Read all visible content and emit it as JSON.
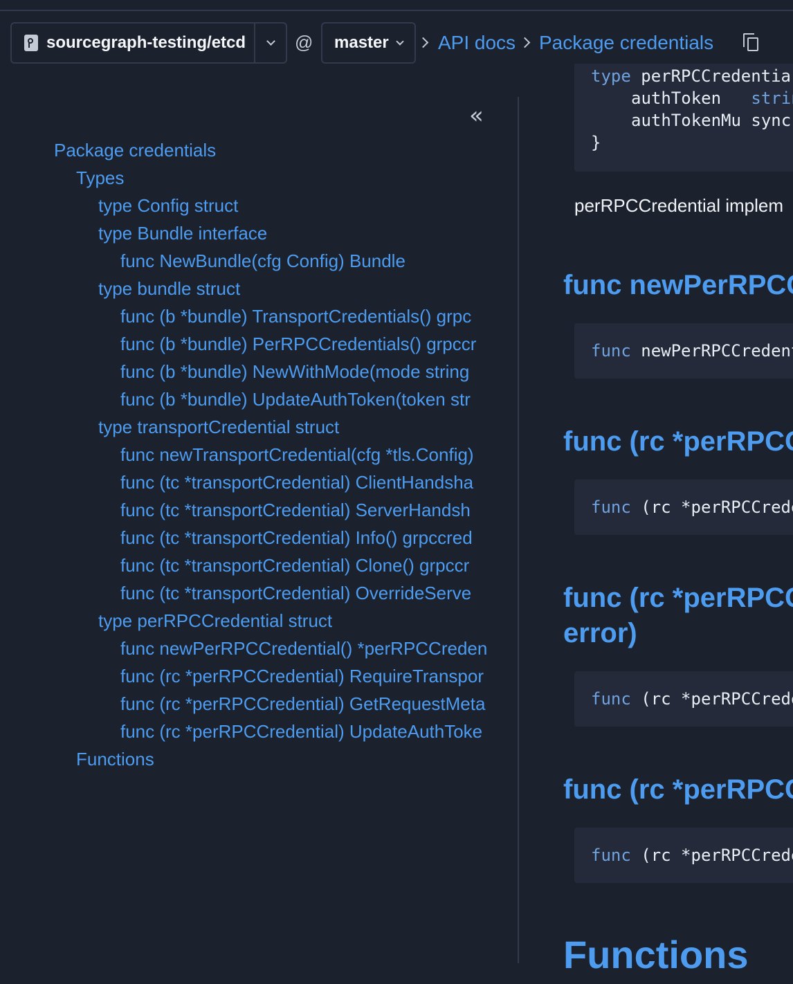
{
  "navbar": {
    "repo": "sourcegraph-testing/etcd",
    "at": "@",
    "revision": "master",
    "breadcrumbs": [
      "API docs",
      "Package credentials"
    ]
  },
  "sidebar": {
    "collapse_glyph": "«",
    "toc": [
      {
        "label": "Package credentials",
        "level": 0
      },
      {
        "label": "Types",
        "level": 1
      },
      {
        "label": "type Config struct",
        "level": 2
      },
      {
        "label": "type Bundle interface",
        "level": 2
      },
      {
        "label": "func NewBundle(cfg Config) Bundle",
        "level": 3
      },
      {
        "label": "type bundle struct",
        "level": 2
      },
      {
        "label": "func (b *bundle) TransportCredentials() grpc",
        "level": 3
      },
      {
        "label": "func (b *bundle) PerRPCCredentials() grpccr",
        "level": 3
      },
      {
        "label": "func (b *bundle) NewWithMode(mode string",
        "level": 3
      },
      {
        "label": "func (b *bundle) UpdateAuthToken(token str",
        "level": 3
      },
      {
        "label": "type transportCredential struct",
        "level": 2
      },
      {
        "label": "func newTransportCredential(cfg *tls.Config)",
        "level": 3
      },
      {
        "label": "func (tc *transportCredential) ClientHandsha",
        "level": 3
      },
      {
        "label": "func (tc *transportCredential) ServerHandsh",
        "level": 3
      },
      {
        "label": "func (tc *transportCredential) Info() grpccred",
        "level": 3
      },
      {
        "label": "func (tc *transportCredential) Clone() grpccr",
        "level": 3
      },
      {
        "label": "func (tc *transportCredential) OverrideServe",
        "level": 3
      },
      {
        "label": "type perRPCCredential struct",
        "level": 2
      },
      {
        "label": "func newPerRPCCredential() *perRPCCreden",
        "level": 3
      },
      {
        "label": "func (rc *perRPCCredential) RequireTranspor",
        "level": 3
      },
      {
        "label": "func (rc *perRPCCredential) GetRequestMeta",
        "level": 3
      },
      {
        "label": "func (rc *perRPCCredential) UpdateAuthToke",
        "level": 3
      },
      {
        "label": "Functions",
        "level": 1
      }
    ]
  },
  "main": {
    "top_code": {
      "line1_kw": "type",
      "line1_rest": " perRPCCredentia",
      "line2_name": "authToken",
      "line2_type": "strin",
      "line3_name": "authTokenMu",
      "line3_type": "sync",
      "line4": "}"
    },
    "description": "perRPCCredential implem",
    "sections": [
      {
        "heading": "func newPerRPCC",
        "code_kw": "func",
        "code_rest": " newPerRPCCredent"
      },
      {
        "heading": "func (rc *perRPCC",
        "code_kw": "func",
        "code_rest": " (rc *perRPCCrede"
      },
      {
        "heading": "func (rc *perRPCC",
        "heading2": "error)",
        "code_kw": "func",
        "code_rest": " (rc *perRPCCrede"
      },
      {
        "heading": "func (rc *perRPCC",
        "code_kw": "func",
        "code_rest": " (rc *perRPCCrede"
      }
    ],
    "functions_heading": "Functions"
  }
}
